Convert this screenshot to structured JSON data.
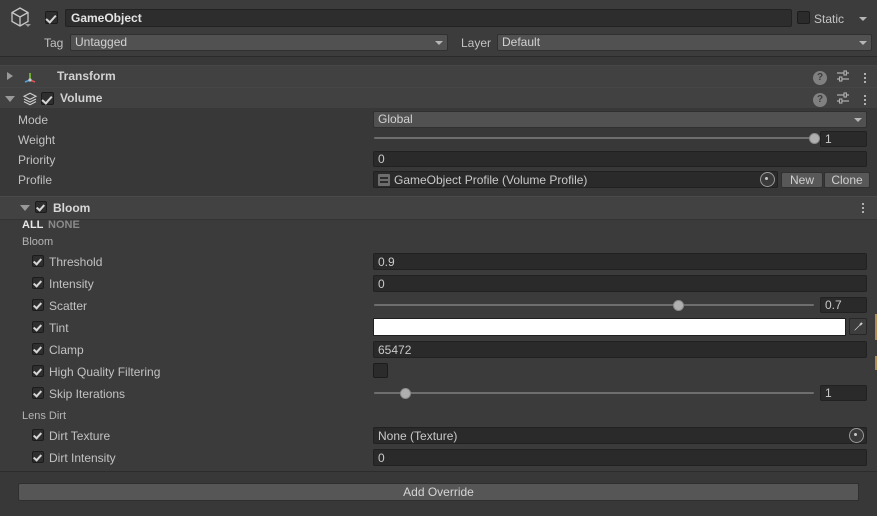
{
  "gameobject": {
    "icon": "cube-icon",
    "enabled": true,
    "name": "GameObject",
    "static_label": "Static",
    "static_checked": false,
    "tag_label": "Tag",
    "tag_value": "Untagged",
    "layer_label": "Layer",
    "layer_value": "Default"
  },
  "components": [
    {
      "name": "Transform",
      "icon": "transform-axis-icon",
      "expanded": false,
      "has_enable_checkbox": false,
      "header_icons": [
        "help-icon",
        "preset-icon",
        "kebab-icon"
      ]
    },
    {
      "name": "Volume",
      "icon": "volume-stack-icon",
      "expanded": true,
      "has_enable_checkbox": true,
      "enabled": true,
      "header_icons": [
        "help-icon",
        "preset-icon",
        "kebab-icon"
      ]
    }
  ],
  "volume": {
    "rows": [
      {
        "label": "Mode",
        "kind": "popup",
        "value": "Global"
      },
      {
        "label": "Weight",
        "kind": "slider-field",
        "value": "1",
        "fraction": 1.0
      },
      {
        "label": "Priority",
        "kind": "field",
        "value": "0"
      },
      {
        "label": "Profile",
        "kind": "object-field",
        "value": "GameObject Profile (Volume Profile)"
      }
    ],
    "profile_buttons": [
      "New",
      "Clone"
    ]
  },
  "bloom": {
    "title": "Bloom",
    "expanded": true,
    "enabled": true,
    "toggle_all": "ALL",
    "toggle_none": "NONE",
    "kebab": "kebab-icon",
    "groups": [
      {
        "title": "Bloom",
        "params": [
          {
            "label": "Threshold",
            "override": true,
            "kind": "field",
            "value": "0.9"
          },
          {
            "label": "Intensity",
            "override": true,
            "kind": "field",
            "value": "0"
          },
          {
            "label": "Scatter",
            "override": true,
            "kind": "slider-field",
            "value": "0.7",
            "fraction": 0.62
          },
          {
            "label": "Tint",
            "override": true,
            "kind": "color",
            "value": "#ffffff"
          },
          {
            "label": "Clamp",
            "override": true,
            "kind": "field",
            "value": "65472"
          },
          {
            "label": "High Quality Filtering",
            "override": true,
            "kind": "checkbox",
            "value": false
          },
          {
            "label": "Skip Iterations",
            "override": true,
            "kind": "slider-field",
            "value": "1",
            "fraction": 0.07
          }
        ]
      },
      {
        "title": "Lens Dirt",
        "params": [
          {
            "label": "Dirt Texture",
            "override": true,
            "kind": "object-field",
            "value": "None (Texture)"
          },
          {
            "label": "Dirt Intensity",
            "override": true,
            "kind": "field",
            "value": "0"
          }
        ]
      }
    ]
  },
  "footer": {
    "add_override_label": "Add Override"
  },
  "colors": {
    "panel_bg": "#383838",
    "header_bg": "#3c3c3c",
    "component_header_bg": "#414141",
    "field_bg": "#2a2a2a",
    "popup_bg": "#515151",
    "button_bg": "#585858",
    "text": "#c2c2c2",
    "override_marker": "#b08a4e"
  }
}
